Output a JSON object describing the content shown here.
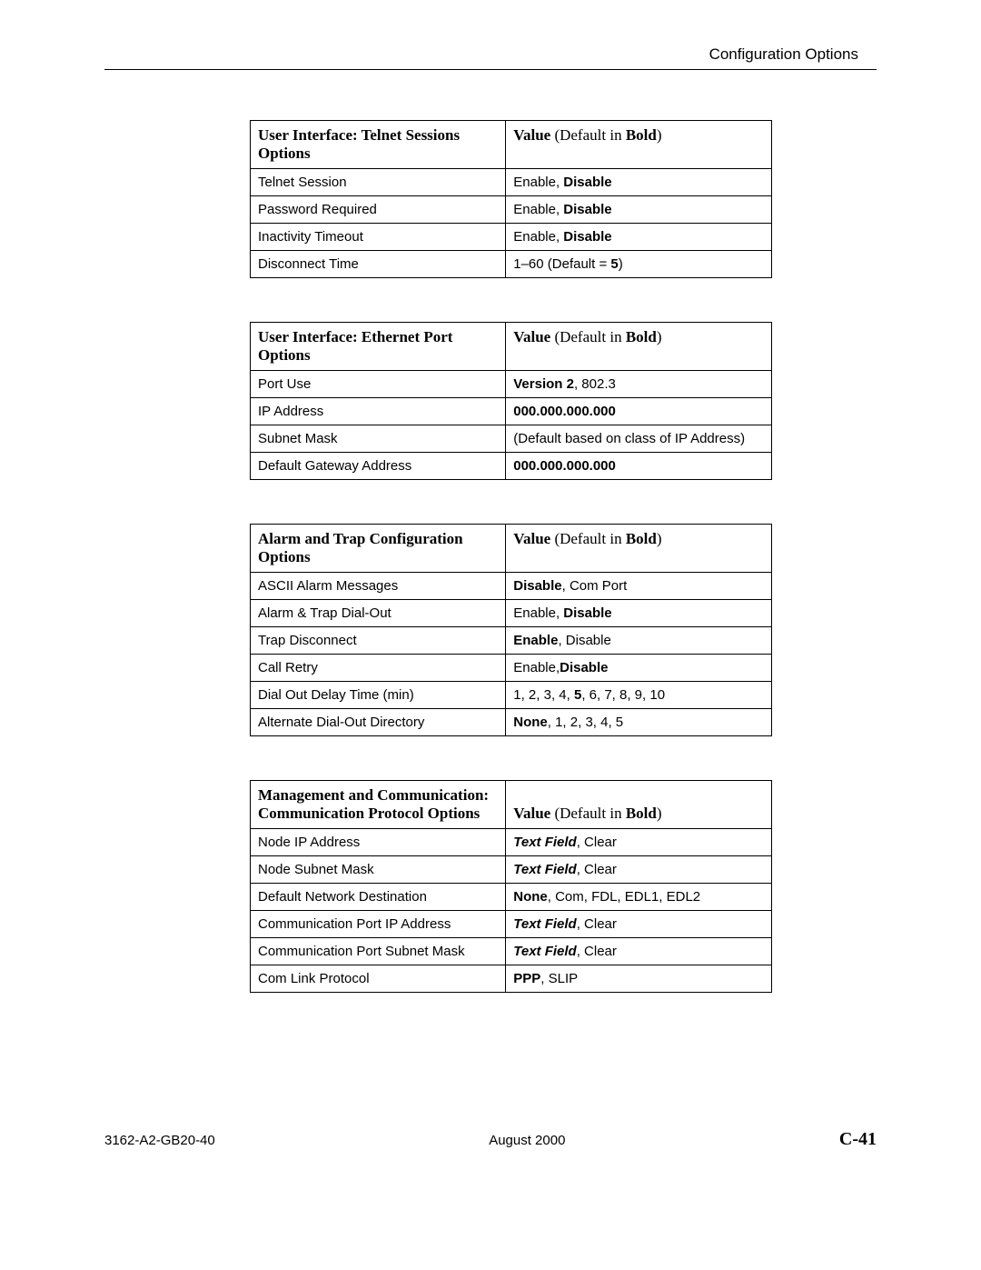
{
  "header": "Configuration Options",
  "value_header": {
    "prefix": "Value ",
    "paren_open": "(Default in ",
    "bold": "Bold",
    "paren_close": ")"
  },
  "tables": {
    "telnet": {
      "title": "User Interface: Telnet Sessions Options",
      "rows": [
        {
          "opt": "Telnet Session",
          "v_pre": "Enable, ",
          "v_bold": "Disable",
          "v_post": ""
        },
        {
          "opt": "Password Required",
          "v_pre": "Enable, ",
          "v_bold": "Disable",
          "v_post": ""
        },
        {
          "opt": "Inactivity Timeout",
          "v_pre": "Enable, ",
          "v_bold": "Disable",
          "v_post": ""
        },
        {
          "opt": "Disconnect Time",
          "v_pre": "1–60 (Default = ",
          "v_bold": "5",
          "v_post": ")"
        }
      ]
    },
    "ethernet": {
      "title": "User Interface: Ethernet Port Options",
      "rows": [
        {
          "opt": "Port Use",
          "v_pre": "",
          "v_bold": "Version 2",
          "v_post": ", 802.3"
        },
        {
          "opt": "IP Address",
          "v_pre": "",
          "v_bold": "000.000.000.000",
          "v_post": ""
        },
        {
          "opt": "Subnet Mask",
          "v_pre": "(Default based on class of IP Address)",
          "v_bold": "",
          "v_post": ""
        },
        {
          "opt": "Default Gateway Address",
          "v_pre": "",
          "v_bold": "000.000.000.000",
          "v_post": ""
        }
      ]
    },
    "alarm": {
      "title": "Alarm and Trap Configuration Options",
      "rows": [
        {
          "opt": "ASCII Alarm Messages",
          "v_pre": "",
          "v_bold": "Disable",
          "v_post": ", Com Port"
        },
        {
          "opt": "Alarm & Trap Dial-Out",
          "v_pre": "Enable, ",
          "v_bold": "Disable",
          "v_post": ""
        },
        {
          "opt": "Trap Disconnect",
          "v_pre": "",
          "v_bold": "Enable",
          "v_post": ", Disable"
        },
        {
          "opt": "Call Retry",
          "v_pre": "Enable,",
          "v_bold": "Disable",
          "v_post": ""
        },
        {
          "opt": "Dial Out Delay Time (min)",
          "v_pre": "1, 2, 3, 4, ",
          "v_bold": "5",
          "v_post": ", 6, 7, 8, 9, 10"
        },
        {
          "opt": "Alternate Dial-Out Directory",
          "v_pre": "",
          "v_bold": "None",
          "v_post": ", 1, 2, 3, 4, 5"
        }
      ]
    },
    "mgmt": {
      "title_line1": "Management and Communication:",
      "title_line2": "Communication Protocol Options",
      "rows": [
        {
          "opt": "Node IP Address",
          "v_boldit": "Text Field",
          "v_post": ", Clear"
        },
        {
          "opt": "Node Subnet Mask",
          "v_boldit": "Text Field",
          "v_post": ", Clear"
        },
        {
          "opt": "Default Network Destination",
          "v_pre": "",
          "v_bold": "None",
          "v_post": ", Com, FDL, EDL1, EDL2"
        },
        {
          "opt": "Communication Port IP Address",
          "v_boldit": "Text Field",
          "v_post": ", Clear"
        },
        {
          "opt": "Communication Port Subnet Mask",
          "v_boldit": "Text Field",
          "v_post": ", Clear"
        },
        {
          "opt": "Com Link Protocol",
          "v_pre": "",
          "v_bold": "PPP",
          "v_post": ", SLIP"
        }
      ]
    }
  },
  "footer": {
    "left": "3162-A2-GB20-40",
    "center": "August 2000",
    "right": "C-41"
  }
}
